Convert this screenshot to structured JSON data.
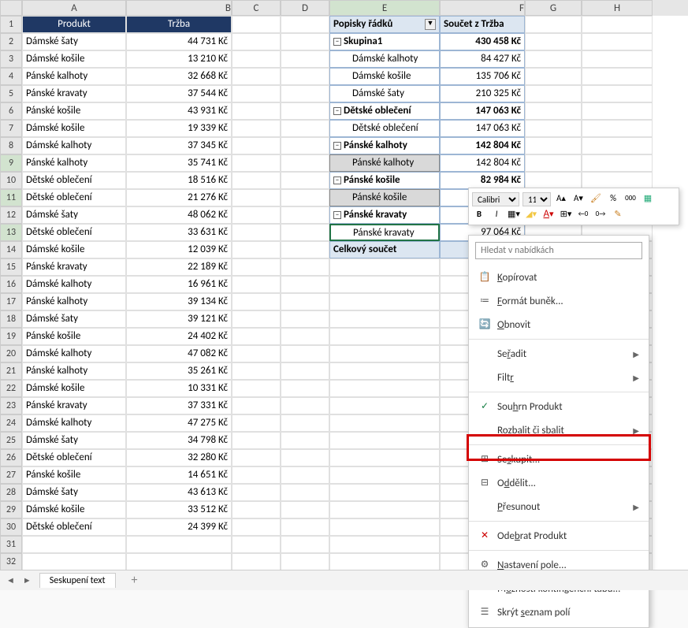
{
  "columns": [
    "A",
    "B",
    "C",
    "D",
    "E",
    "F",
    "G",
    "H"
  ],
  "colWidths": {
    "A": 132,
    "B": 134,
    "C": 62,
    "D": 62,
    "E": 140,
    "F": 108,
    "G": 72,
    "H": 90
  },
  "headers": {
    "A": "Produkt",
    "B": "Tržba"
  },
  "data_rows": [
    {
      "produkt": "Dámské šaty",
      "trzba": "44 731 Kč"
    },
    {
      "produkt": "Dámské košile",
      "trzba": "13 210 Kč"
    },
    {
      "produkt": "Pánské kalhoty",
      "trzba": "32 668 Kč"
    },
    {
      "produkt": "Pánské kravaty",
      "trzba": "37 544 Kč"
    },
    {
      "produkt": "Pánské košile",
      "trzba": "43 931 Kč"
    },
    {
      "produkt": "Dámské košile",
      "trzba": "19 339 Kč"
    },
    {
      "produkt": "Dámské kalhoty",
      "trzba": "37 345 Kč"
    },
    {
      "produkt": "Pánské kalhoty",
      "trzba": "35 741 Kč"
    },
    {
      "produkt": "Dětské oblečení",
      "trzba": "18 516 Kč"
    },
    {
      "produkt": "Dětské oblečení",
      "trzba": "21 276 Kč"
    },
    {
      "produkt": "Dámské šaty",
      "trzba": "48 062 Kč"
    },
    {
      "produkt": "Dětské oblečení",
      "trzba": "33 631 Kč"
    },
    {
      "produkt": "Dámské košile",
      "trzba": "12 039 Kč"
    },
    {
      "produkt": "Pánské kravaty",
      "trzba": "22 189 Kč"
    },
    {
      "produkt": "Dámské kalhoty",
      "trzba": "16 961 Kč"
    },
    {
      "produkt": "Pánské kalhoty",
      "trzba": "39 134 Kč"
    },
    {
      "produkt": "Dámské šaty",
      "trzba": "39 121 Kč"
    },
    {
      "produkt": "Pánské košile",
      "trzba": "24 402 Kč"
    },
    {
      "produkt": "Dámské kalhoty",
      "trzba": "47 082 Kč"
    },
    {
      "produkt": "Pánské kalhoty",
      "trzba": "35 261 Kč"
    },
    {
      "produkt": "Dámské košile",
      "trzba": "10 331 Kč"
    },
    {
      "produkt": "Pánské kravaty",
      "trzba": "37 331 Kč"
    },
    {
      "produkt": "Dámské kalhoty",
      "trzba": "47 275 Kč"
    },
    {
      "produkt": "Dámské šaty",
      "trzba": "34 798 Kč"
    },
    {
      "produkt": "Dětské oblečení",
      "trzba": "32 280 Kč"
    },
    {
      "produkt": "Pánské košile",
      "trzba": "14 651 Kč"
    },
    {
      "produkt": "Dámské šaty",
      "trzba": "43 613 Kč"
    },
    {
      "produkt": "Dámské košile",
      "trzba": "33 512 Kč"
    },
    {
      "produkt": "Dětské oblečení",
      "trzba": "24 399 Kč"
    }
  ],
  "pivot": {
    "header_labels": "Popisky řádků",
    "header_sum": "Součet z Tržba",
    "rows": [
      {
        "type": "group",
        "label": "Skupina1",
        "val": "430 458 Kč",
        "exp": "−"
      },
      {
        "type": "item",
        "label": "Dámské kalhoty",
        "val": "84 427 Kč"
      },
      {
        "type": "item",
        "label": "Dámské košile",
        "val": "135 706 Kč"
      },
      {
        "type": "item",
        "label": "Dámské šaty",
        "val": "210 325 Kč"
      },
      {
        "type": "group",
        "label": "Dětské oblečení",
        "val": "147 063 Kč",
        "exp": "−"
      },
      {
        "type": "item",
        "label": "Dětské oblečení",
        "val": "147 063 Kč"
      },
      {
        "type": "group",
        "label": "Pánské kalhoty",
        "val": "142 804 Kč",
        "exp": "−"
      },
      {
        "type": "item",
        "label": "Pánské kalhoty",
        "val": "142 804 Kč",
        "sel": true
      },
      {
        "type": "group",
        "label": "Pánské košile",
        "val": "82 984 Kč",
        "exp": "−"
      },
      {
        "type": "item",
        "label": "Pánské košile",
        "val": "",
        "sel": true
      },
      {
        "type": "group",
        "label": "Pánské kravaty",
        "val": "",
        "exp": "−"
      },
      {
        "type": "item",
        "label": "Pánské kravaty",
        "val": "97 064 Kč",
        "sel": true,
        "active": true
      }
    ],
    "total_label": "Celkový součet",
    "total_val": ""
  },
  "minitoolbar": {
    "font": "Calibri",
    "size": "11",
    "increase": "A↑",
    "decrease": "A↓",
    "bold": "B",
    "italic": "I"
  },
  "context_menu": {
    "search_placeholder": "Hledat v nabídkách",
    "items": [
      {
        "icon": "📋",
        "label": "Kopírovat"
      },
      {
        "icon": "≔",
        "label": "Formát buněk..."
      },
      {
        "icon": "🔄",
        "label": "Obnovit"
      },
      {
        "sep": true
      },
      {
        "icon": "",
        "label": "Seřadit",
        "sub": true
      },
      {
        "icon": "",
        "label": "Filtr",
        "sub": true
      },
      {
        "sep": true
      },
      {
        "icon": "✓",
        "label": "Souhrn Produkt",
        "checked": true
      },
      {
        "icon": "",
        "label": "Rozbalit či sbalit",
        "sub": true
      },
      {
        "sep": true
      },
      {
        "icon": "⊞",
        "label": "Seskupit...",
        "highlight": true
      },
      {
        "icon": "⊟",
        "label": "Oddělit..."
      },
      {
        "icon": "",
        "label": "Přesunout",
        "sub": true
      },
      {
        "sep": true
      },
      {
        "icon": "✕",
        "label": "Odebrat Produkt",
        "red": true
      },
      {
        "sep": true
      },
      {
        "icon": "⚙",
        "label": "Nastavení pole..."
      },
      {
        "icon": "",
        "label": "Možnosti kontingenční tabu..."
      },
      {
        "icon": "☰",
        "label": "Skrýt seznam polí"
      }
    ]
  },
  "tabs": {
    "active": "Seskupení text",
    "add": "+"
  },
  "selected_rows": [
    9,
    11,
    13
  ],
  "selected_col": "E"
}
